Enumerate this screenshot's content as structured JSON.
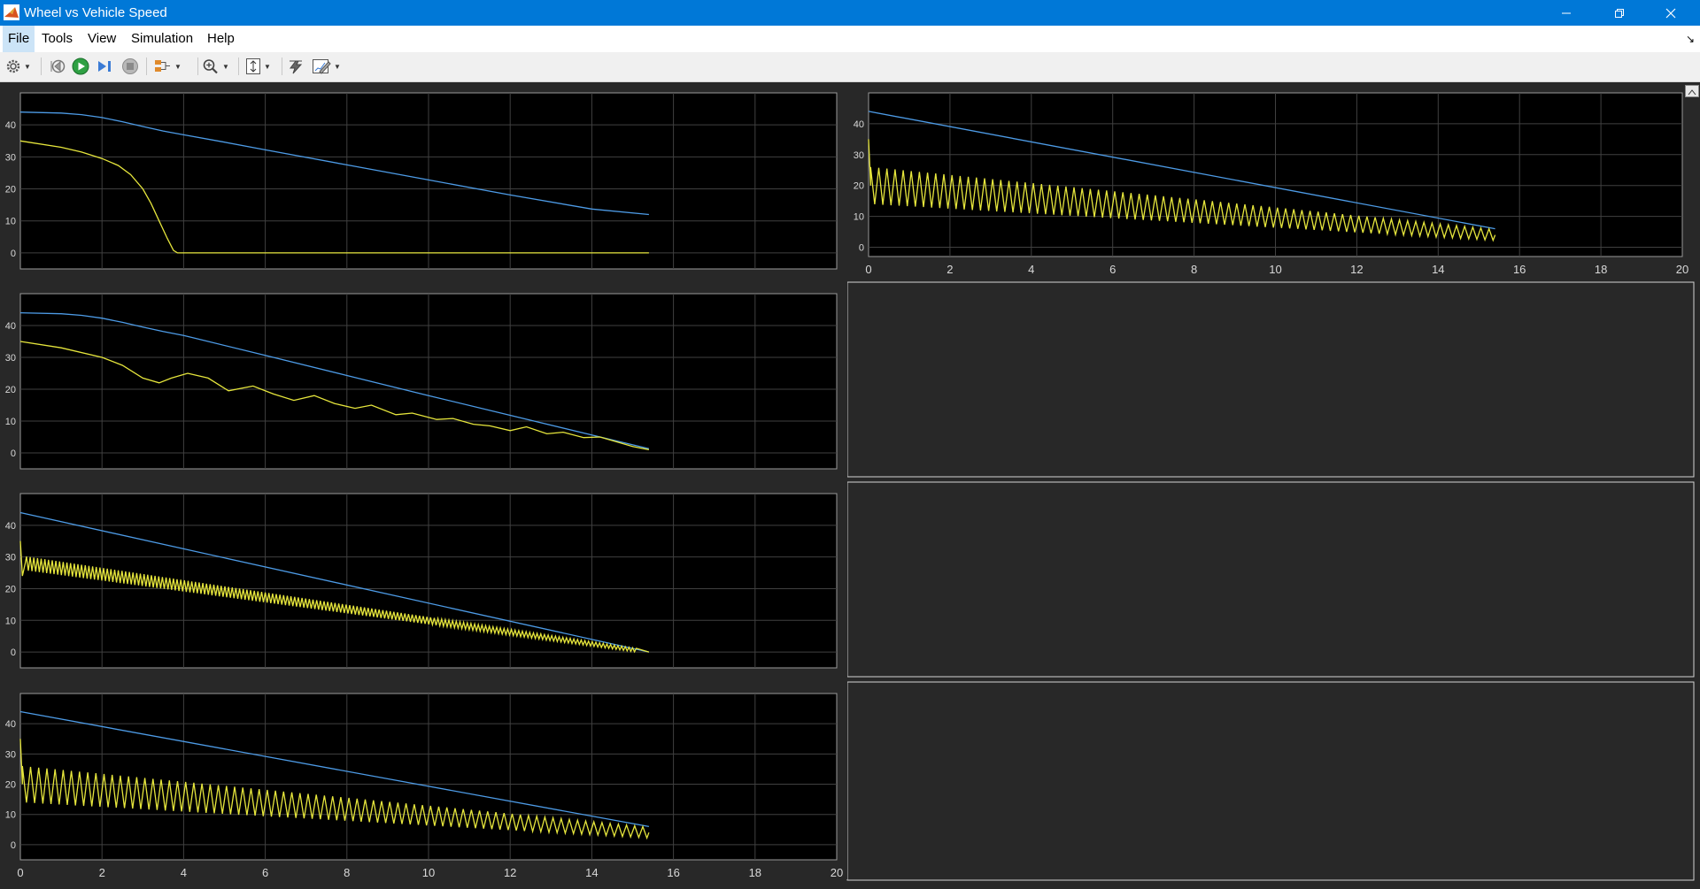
{
  "window": {
    "title": "Wheel vs Vehicle Speed"
  },
  "menu": [
    {
      "id": "file",
      "label": "File",
      "active": true
    },
    {
      "id": "tools",
      "label": "Tools"
    },
    {
      "id": "view",
      "label": "View"
    },
    {
      "id": "simulation",
      "label": "Simulation"
    },
    {
      "id": "help",
      "label": "Help"
    }
  ],
  "toolbar": [
    {
      "id": "settings",
      "icon": "gear-icon",
      "dropdown": true
    },
    {
      "id": "step-back",
      "icon": "step-back-icon"
    },
    {
      "id": "run",
      "icon": "play-icon"
    },
    {
      "id": "step-forward",
      "icon": "step-forward-icon"
    },
    {
      "id": "stop",
      "icon": "stop-icon"
    },
    {
      "id": "highlight",
      "icon": "highlight-block-icon",
      "dropdown": true
    },
    {
      "id": "zoom",
      "icon": "zoom-in-icon",
      "dropdown": true
    },
    {
      "id": "autoscale",
      "icon": "fit-to-view-icon",
      "dropdown": true
    },
    {
      "id": "signal-tool",
      "icon": "signal-tool-icon"
    },
    {
      "id": "style",
      "icon": "style-edit-icon",
      "dropdown": true
    }
  ],
  "colors": {
    "vehicle_speed": "#4d9be6",
    "wheel_speed": "#e6e63c",
    "axes_background": "#000000",
    "figure_background": "#282828",
    "grid": "#404040",
    "tick_text": "#d9d9d9"
  },
  "chart_data": [
    {
      "type": "line",
      "position": "left-row-1",
      "xlim": [
        0,
        20
      ],
      "ylim": [
        -5,
        50
      ],
      "yticks": [
        0,
        10,
        20,
        30,
        40
      ],
      "xticks": [
        0,
        2,
        4,
        6,
        8,
        10,
        12,
        14,
        16,
        18,
        20
      ],
      "show_xtick_labels": false,
      "series": [
        {
          "color": "#4d9be6",
          "x": [
            0,
            1,
            1.5,
            2,
            2.5,
            3,
            3.5,
            4,
            5,
            6,
            8,
            10,
            12,
            14,
            15.4
          ],
          "y": [
            44,
            43.7,
            43.2,
            42.3,
            41,
            39.5,
            38.1,
            36.9,
            34.6,
            32.2,
            27.5,
            22.8,
            18.1,
            13.7,
            12
          ]
        },
        {
          "color": "#e6e63c",
          "x": [
            0,
            1,
            1.5,
            2,
            2.4,
            2.7,
            3,
            3.2,
            3.4,
            3.6,
            3.75,
            3.85,
            5,
            10,
            15.4
          ],
          "y": [
            35,
            33,
            31.5,
            29.5,
            27.3,
            24.5,
            20,
            15.5,
            10,
            4.5,
            0.8,
            0,
            0,
            0,
            0
          ]
        }
      ]
    },
    {
      "type": "line",
      "position": "left-row-2",
      "xlim": [
        0,
        20
      ],
      "ylim": [
        -5,
        50
      ],
      "yticks": [
        0,
        10,
        20,
        30,
        40
      ],
      "xticks": [
        0,
        2,
        4,
        6,
        8,
        10,
        12,
        14,
        16,
        18,
        20
      ],
      "show_xtick_labels": false,
      "series": [
        {
          "color": "#4d9be6",
          "x": [
            0,
            1,
            1.5,
            2,
            2.5,
            3,
            3.5,
            4,
            6,
            8,
            10,
            12,
            14,
            15.4
          ],
          "y": [
            44,
            43.7,
            43.2,
            42.3,
            41,
            39.5,
            38.1,
            36.9,
            30.6,
            24.3,
            18,
            11.8,
            5.6,
            1.3
          ]
        },
        {
          "color": "#e6e63c",
          "x": [
            0,
            1,
            2,
            2.5,
            3,
            3.4,
            3.7,
            4.1,
            4.6,
            5.1,
            5.7,
            6.2,
            6.7,
            7.2,
            7.7,
            8.2,
            8.6,
            9.2,
            9.6,
            10.2,
            10.6,
            11.1,
            11.5,
            12,
            12.4,
            12.9,
            13.3,
            13.8,
            14.2,
            14.6,
            15,
            15.4
          ],
          "y": [
            35,
            33,
            30,
            27.5,
            23.5,
            22,
            23.5,
            25,
            23.5,
            19.5,
            21,
            18.5,
            16.5,
            18,
            15.5,
            14,
            15,
            12,
            12.5,
            10.5,
            10.8,
            9,
            8.5,
            7,
            8.2,
            6,
            6.5,
            4.8,
            5,
            3.5,
            2,
            1
          ]
        }
      ]
    },
    {
      "type": "line",
      "position": "left-row-3",
      "xlim": [
        0,
        20
      ],
      "ylim": [
        -5,
        50
      ],
      "yticks": [
        0,
        10,
        20,
        30,
        40
      ],
      "xticks": [
        0,
        2,
        4,
        6,
        8,
        10,
        12,
        14,
        16,
        18,
        20
      ],
      "show_xtick_labels": false,
      "series": [
        {
          "color": "#4d9be6",
          "x": [
            0,
            15.4
          ],
          "y": [
            44,
            0
          ]
        },
        {
          "color": "#e6e63c",
          "x": [
            0,
            0.05,
            0.12,
            15.4
          ],
          "y": [
            35,
            24,
            28,
            0
          ],
          "oscillation": {
            "start": 0.15,
            "end": 15.1,
            "period": 0.09,
            "amplitude_start": 2.2,
            "amplitude_end": 0.6
          }
        }
      ]
    },
    {
      "type": "line",
      "position": "left-row-4",
      "xlim": [
        0,
        20
      ],
      "ylim": [
        -5,
        50
      ],
      "yticks": [
        0,
        10,
        20,
        30,
        40
      ],
      "xticks": [
        0,
        2,
        4,
        6,
        8,
        10,
        12,
        14,
        16,
        18,
        20
      ],
      "show_xtick_labels": true,
      "series": [
        {
          "color": "#4d9be6",
          "x": [
            0,
            15.4
          ],
          "y": [
            44,
            6
          ]
        },
        {
          "color": "#e6e63c",
          "x": [
            0,
            0.05,
            15.4
          ],
          "y": [
            35,
            20,
            4
          ],
          "oscillation": {
            "start": 0.05,
            "end": 15.4,
            "period": 0.2,
            "amplitude_start": 6,
            "amplitude_end": 1.8
          }
        }
      ]
    },
    {
      "type": "line",
      "position": "right-row-1",
      "xlim": [
        0,
        20
      ],
      "ylim": [
        -3,
        50
      ],
      "yticks": [
        0,
        10,
        20,
        30,
        40
      ],
      "xticks": [
        0,
        2,
        4,
        6,
        8,
        10,
        12,
        14,
        16,
        18,
        20
      ],
      "show_xtick_labels": true,
      "series": [
        {
          "color": "#4d9be6",
          "x": [
            0,
            15.4
          ],
          "y": [
            44,
            6
          ]
        },
        {
          "color": "#e6e63c",
          "x": [
            0,
            0.05,
            15.4
          ],
          "y": [
            35,
            20,
            4
          ],
          "oscillation": {
            "start": 0.05,
            "end": 15.4,
            "period": 0.2,
            "amplitude_start": 6,
            "amplitude_end": 1.8
          }
        }
      ]
    }
  ]
}
